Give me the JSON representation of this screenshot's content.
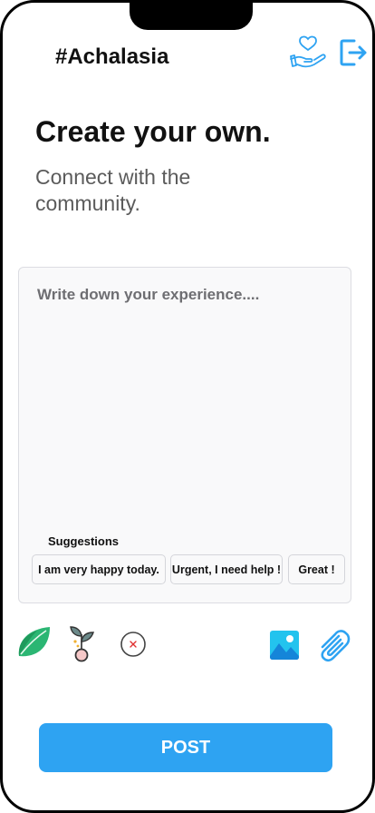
{
  "header": {
    "hashtag": "#Achalasia"
  },
  "hero": {
    "title": "Create your own.",
    "subtitle": "Connect with the community."
  },
  "composer": {
    "placeholder": "Write down your experience....",
    "suggestions_label": "Suggestions",
    "suggestions": [
      "I am very happy today.",
      "Urgent, I need help !",
      "Great !"
    ]
  },
  "toolbar": {
    "icons": [
      "leaf-icon",
      "sprout-icon",
      "close-circle-icon",
      "image-icon",
      "paperclip-icon"
    ]
  },
  "actions": {
    "post_label": "POST"
  },
  "colors": {
    "accent": "#2EA3F2",
    "text": "#111111",
    "muted": "#5B5B5B",
    "card": "#F9F9FA",
    "leaf": "#2BB673"
  }
}
